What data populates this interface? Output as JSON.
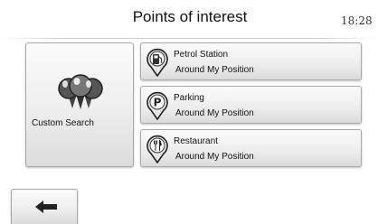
{
  "header": {
    "title": "Points of interest",
    "time": "18:28"
  },
  "custom_search": {
    "label": "Custom Search",
    "icon": "poi-balloons-icon"
  },
  "categories": [
    {
      "name": "Petrol Station",
      "subtitle": "Around My Position",
      "icon": "fuel-pump-icon"
    },
    {
      "name": "Parking",
      "subtitle": "Around My Position",
      "icon": "parking-icon"
    },
    {
      "name": "Restaurant",
      "subtitle": "Around My Position",
      "icon": "restaurant-icon"
    }
  ],
  "footer": {
    "back_icon": "back-arrow-icon"
  }
}
